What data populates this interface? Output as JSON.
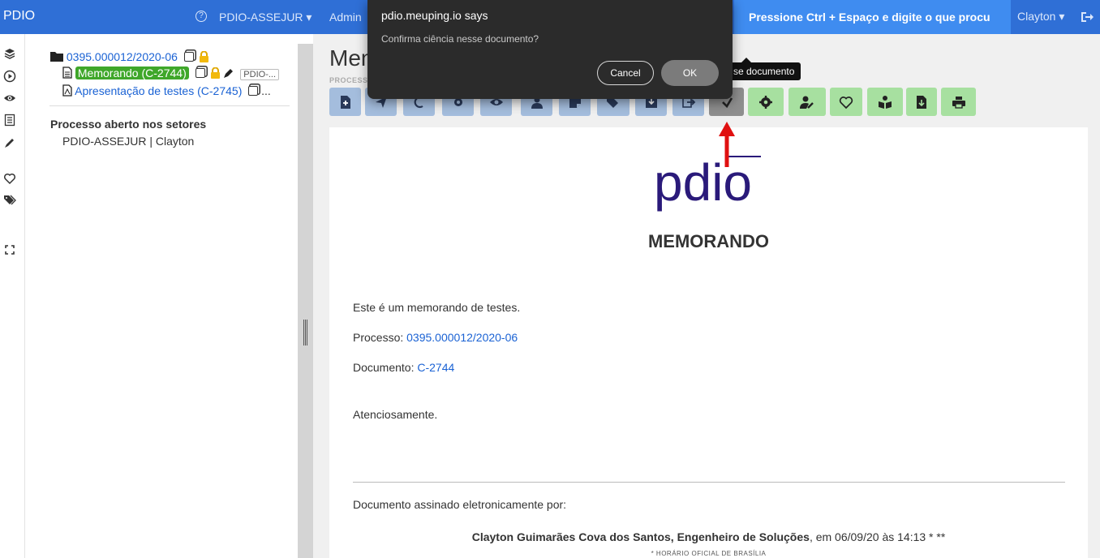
{
  "navbar": {
    "brand": "PDIO",
    "help_glyph": "?",
    "unit": "PDIO-ASSEJUR",
    "admin": "Admin",
    "search_prompt": "Pressione Ctrl + Espaço e digite o que procu",
    "user": "Clayton",
    "caret": "▾"
  },
  "sidebar_icons": [
    "layers-icon",
    "play-icon",
    "eye-icon",
    "list-icon",
    "pen-icon",
    "heart-icon",
    "tags-icon",
    "expand-icon"
  ],
  "tree": {
    "process_number": "0395.000012/2020-06",
    "doc1_label": "Memorando (C-2744)",
    "doc1_badge": "PDIO-...",
    "doc2_label": "Apresentação de testes (C-2745)",
    "doc2_more": "...",
    "sectors_title": "Processo aberto nos setores",
    "sectors_value": "PDIO-ASSEJUR | Clayton"
  },
  "main": {
    "title": "Mem",
    "small_label": "PROCESS",
    "tooltip": "se documento"
  },
  "toolbar": {
    "blue_buttons": [
      "new-document-icon",
      "send-icon",
      "refresh-icon",
      "settings-icon",
      "view-icon",
      "user-icon",
      "note-icon",
      "tags-icon",
      "download-icon",
      "forward-icon"
    ],
    "active_button": "check-icon",
    "green_buttons": [
      "gear-icon",
      "user-edit-icon",
      "heart-icon",
      "book-reader-icon",
      "file-download-icon",
      "print-icon"
    ]
  },
  "document": {
    "logo_text": "pdio",
    "heading": "MEMORANDO",
    "line1": "Este é um memorando de testes.",
    "process_label": "Processo: ",
    "process_value": "0395.000012/2020-06",
    "doc_label": "Documento: ",
    "doc_value": "C-2744",
    "closing": "Atenciosamente.",
    "signed_by": "Documento assinado eletronicamente por:",
    "signer_name": "Clayton Guimarães Cova dos Santos, Engenheiro de Soluções",
    "signer_date": ", em 06/09/20 às 14:13 * **",
    "footer_note": "* HORÁRIO OFICIAL DE BRASÍLIA"
  },
  "dialog": {
    "title": "pdio.meuping.io says",
    "message": "Confirma ciência nesse documento?",
    "cancel": "Cancel",
    "ok": "OK"
  },
  "colors": {
    "navbar": "#2f6fd6",
    "search_bg": "#3f8cf0",
    "highlight_green": "#3fa72a",
    "toolbar_blue": "#a4bddd",
    "toolbar_green": "#a7e0a0",
    "logo_purple": "#2a1a7a",
    "arrow_red": "#e01010"
  }
}
